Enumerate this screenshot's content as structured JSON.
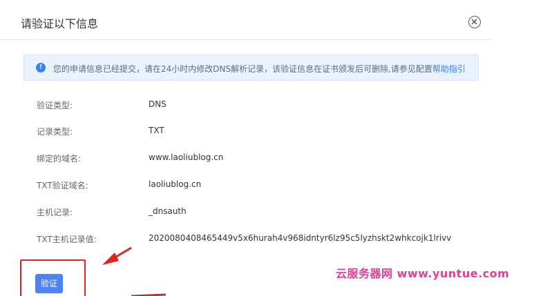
{
  "dialog": {
    "title": "请验证以下信息",
    "close_icon": "circle-close-icon"
  },
  "notice": {
    "icon": "info-circle-icon",
    "icon_glyph": "!",
    "text": "您的申请信息已经提交，请在24小时内修改DNS解析记录，该验证信息在证书颁发后可删除,请参见配置",
    "link": "帮助指引",
    "accent_color": "#3b82f6"
  },
  "fields": [
    {
      "label": "验证类型:",
      "value": "DNS"
    },
    {
      "label": "记录类型:",
      "value": "TXT"
    },
    {
      "label": "绑定的域名:",
      "value": "www.laoliublog.cn"
    },
    {
      "label": "TXT验证域名:",
      "value": "laoliublog.cn"
    },
    {
      "label": "主机记录:",
      "value": "_dnsauth"
    },
    {
      "label": "TXT主机记录值:",
      "value": "2020080408465449v5x6hurah4v968idntyr6lz95c5lyzhskt2whkcojk1lrivv"
    }
  ],
  "actions": {
    "verify_label": "验证",
    "button_color": "#4f83f2"
  },
  "annotation": {
    "color": "#e62020"
  },
  "watermark": {
    "text": "云服务器网 www.yuntue.com",
    "color": "#e0409a"
  }
}
